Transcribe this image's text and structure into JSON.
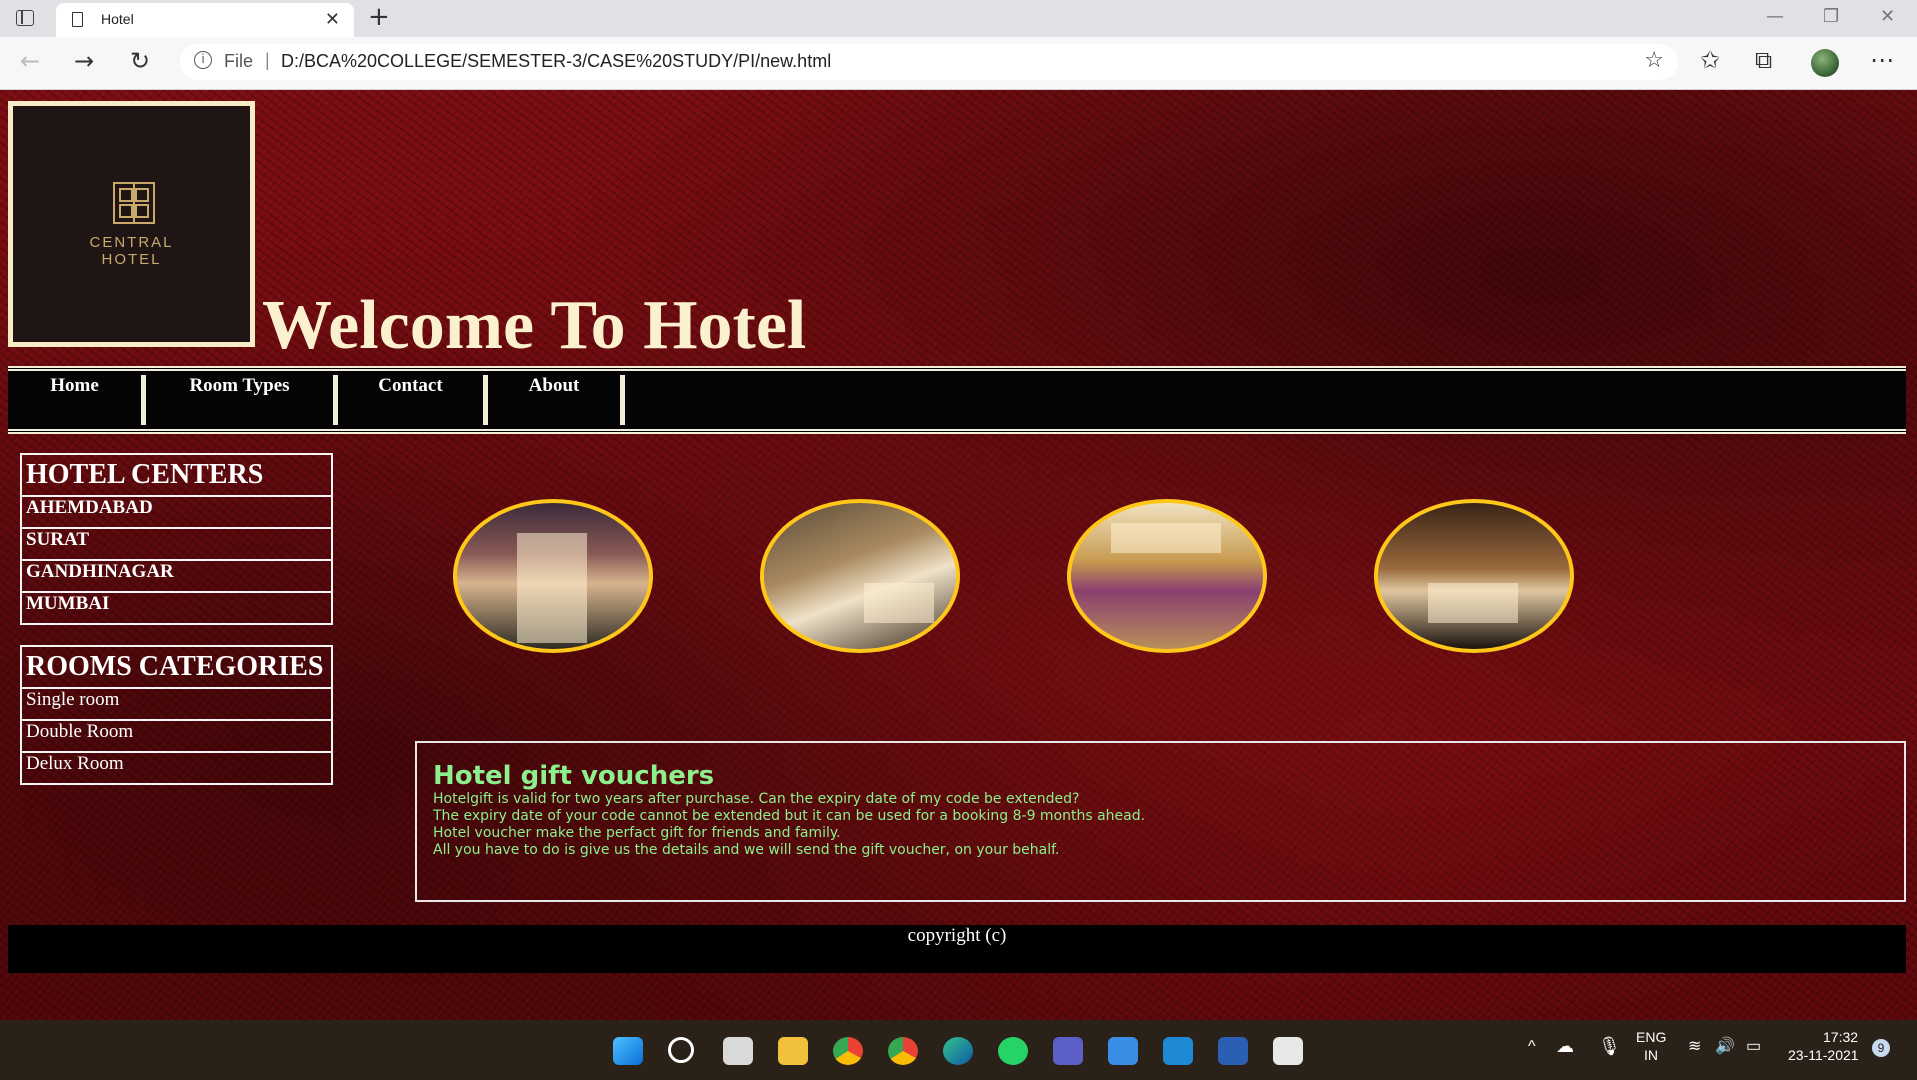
{
  "browser": {
    "tab_title": "Hotel",
    "tab_close": "✕",
    "new_tab": "+",
    "address_scheme": "File",
    "address_url": "D:/BCA%20COLLEGE/SEMESTER-3/CASE%20STUDY/PI/new.html"
  },
  "page": {
    "logo": {
      "line1": "CENTRAL",
      "line2": "HOTEL"
    },
    "welcome": "Welcome To Hotel",
    "nav": [
      "Home",
      "Room Types",
      "Contact",
      "About"
    ],
    "centers": {
      "title": "HOTEL CENTERS",
      "items": [
        "AHEMDABAD",
        "SURAT",
        "GANDHINAGAR",
        "MUMBAI"
      ]
    },
    "rooms": {
      "title": "ROOMS CATEGORIES",
      "items": [
        "Single room",
        "Double Room",
        "Delux Room"
      ]
    },
    "gift": {
      "title": "Hotel gift vouchers",
      "lines": [
        "Hotelgift is valid for two years after purchase. Can the expiry date of my code be extended?",
        "The expiry date of your code cannot be extended but it can be used for a booking 8-9 months ahead.",
        "Hotel voucher make the perfact gift for friends and family.",
        "All you have to do is give us the details and we will send the gift voucher, on your behalf."
      ]
    },
    "footer": "copyright (c)"
  },
  "taskbar": {
    "lang_top": "ENG",
    "lang_bottom": "IN",
    "time": "17:32",
    "date": "23-11-2021",
    "notifications": "9"
  },
  "colors": {
    "accent_cream": "#fbf1cf",
    "voucher_green": "#8cf08c",
    "picture_border": "#ffc71a",
    "background_red": "#6e0c10"
  }
}
